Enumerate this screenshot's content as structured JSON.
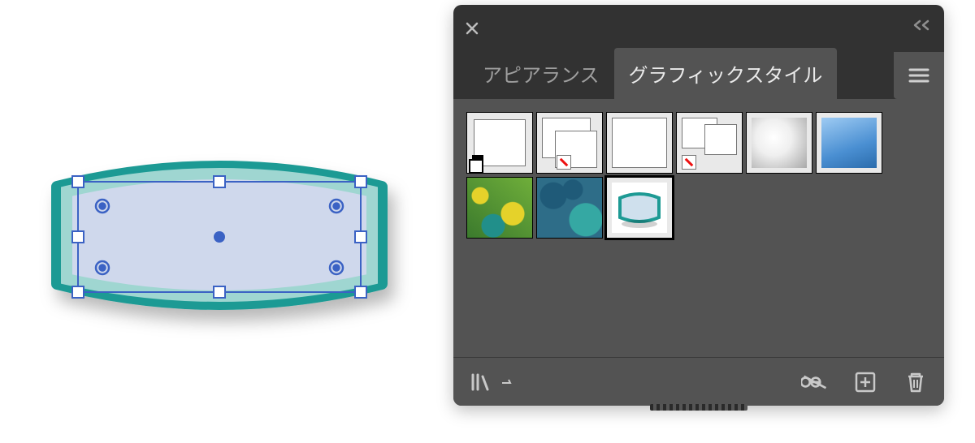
{
  "panel": {
    "tabs": [
      {
        "label": "アピアランス",
        "active": false
      },
      {
        "label": "グラフィックスタイル",
        "active": true
      }
    ],
    "styles": [
      {
        "name": "default-style"
      },
      {
        "name": "offset-rect-style"
      },
      {
        "name": "plain-rect-style"
      },
      {
        "name": "two-box-style"
      },
      {
        "name": "radial-gradient-style"
      },
      {
        "name": "blue-gradient-style"
      },
      {
        "name": "green-pattern-style"
      },
      {
        "name": "blue-pattern-style"
      },
      {
        "name": "custom-teal-shape-style"
      }
    ],
    "selected_style_index": 8
  },
  "colors": {
    "teal_stroke": "#1d9a94",
    "teal_light": "#9fd6d1",
    "shape_fill": "#cfd8ec",
    "selection_blue": "#3b62c4"
  }
}
